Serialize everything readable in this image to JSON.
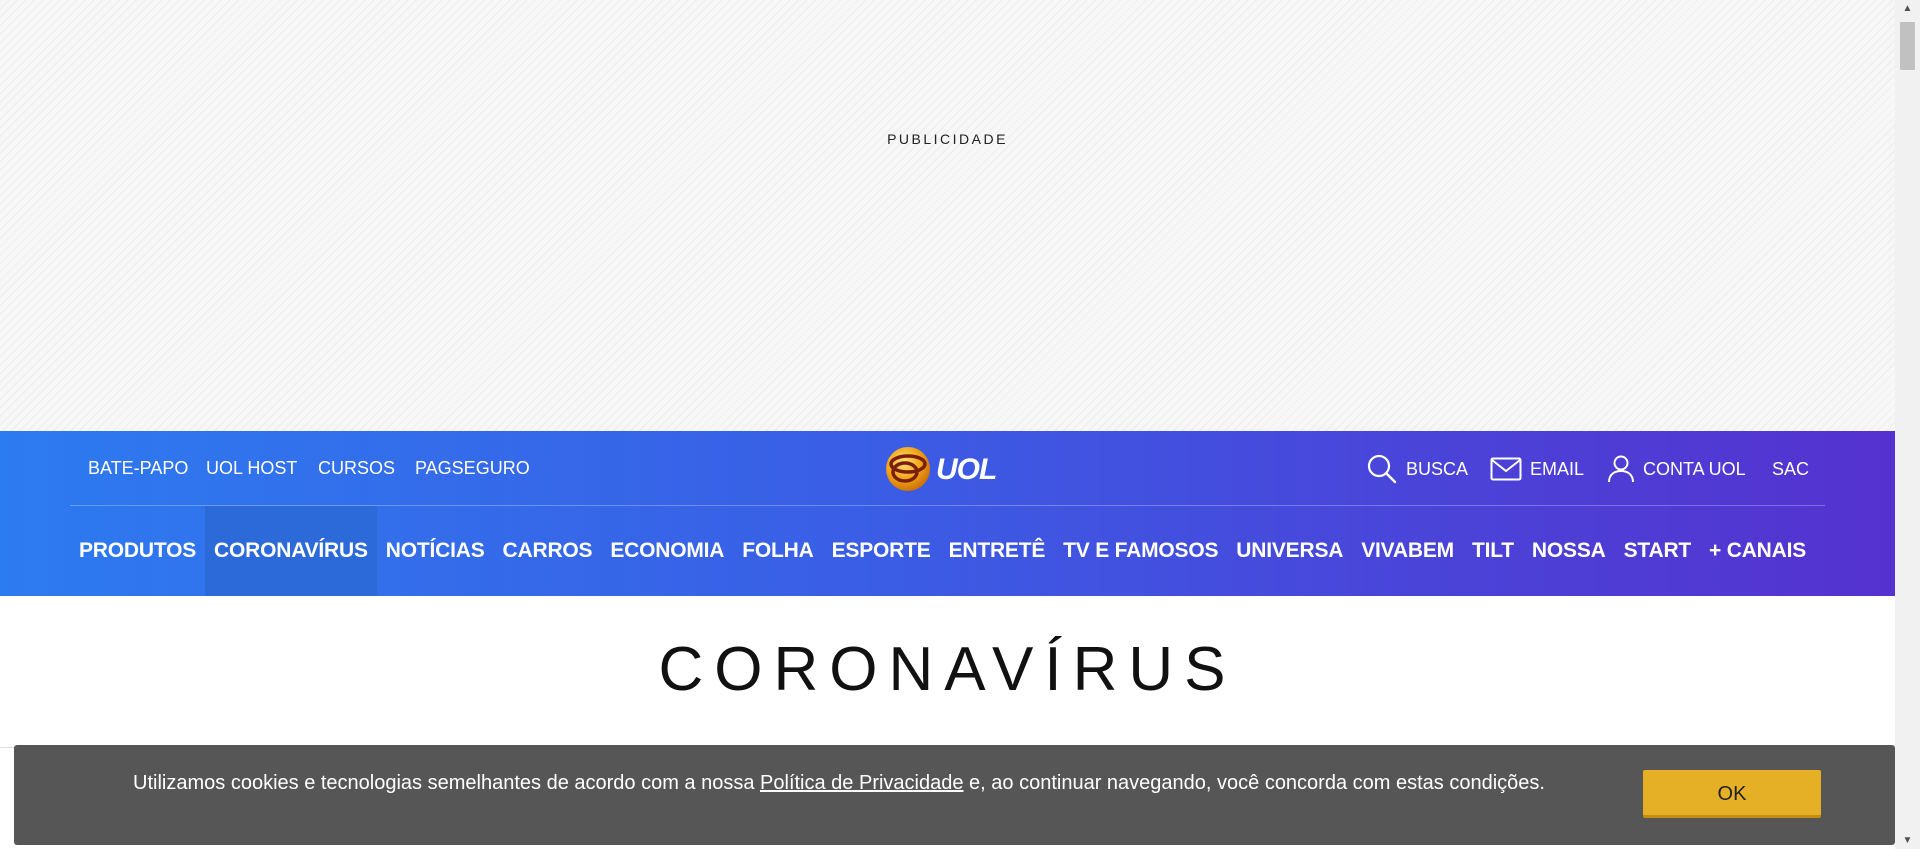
{
  "ad": {
    "label": "PUBLICIDADE"
  },
  "header": {
    "top_links": [
      "BATE-PAPO",
      "UOL HOST",
      "CURSOS",
      "PAGSEGURO"
    ],
    "logo_text": "UOL",
    "utility": {
      "busca": "BUSCA",
      "email": "EMAIL",
      "conta": "CONTA UOL",
      "sac": "SAC"
    },
    "nav": [
      "PRODUTOS",
      "CORONAVÍRUS",
      "NOTÍCIAS",
      "CARROS",
      "ECONOMIA",
      "FOLHA",
      "ESPORTE",
      "ENTRETÊ",
      "TV E FAMOSOS",
      "UNIVERSA",
      "VIVABEM",
      "TILT",
      "NOSSA",
      "START",
      "+ CANAIS"
    ],
    "active_nav": "CORONAVÍRUS"
  },
  "section": {
    "title": "CORONAVÍRUS"
  },
  "cookie": {
    "text_before": "Utilizamos cookies e tecnologias semelhantes de acordo com a nossa ",
    "link_text": "Política de Privacidade",
    "text_after": " e, ao continuar navegando, você concorda com estas condições.",
    "ok_label": "OK"
  },
  "colors": {
    "header_gradient_start": "#2d7bf0",
    "header_gradient_end": "#5532cf",
    "active_nav_bg": "#2c6ad9",
    "cookie_bg": "#565656",
    "ok_button": "#e5b025"
  },
  "icons": [
    "search-icon",
    "mail-icon",
    "user-icon",
    "uol-logo-icon"
  ]
}
